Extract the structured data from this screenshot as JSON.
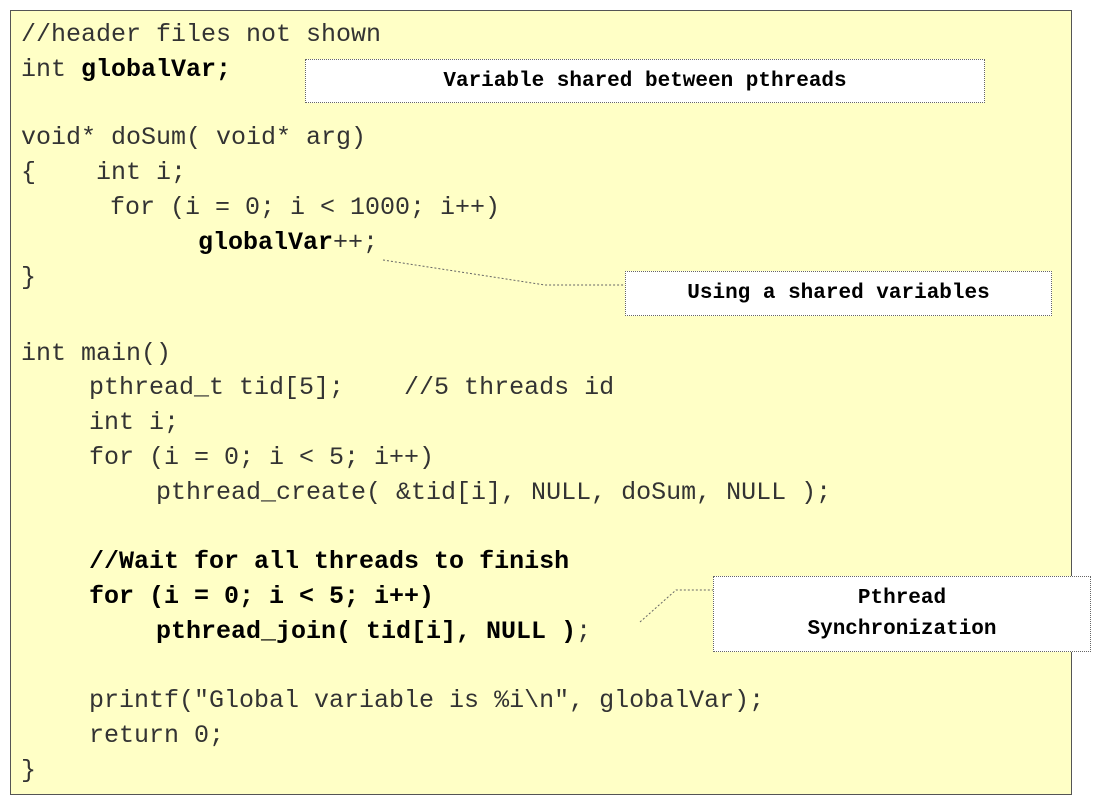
{
  "code": {
    "header_comment": "//header files not shown",
    "global_decl_prefix": "int ",
    "global_decl_var": "globalVar;",
    "func_sig": "void* doSum( void* arg)",
    "func_open": "{    int i;",
    "func_for": "for (i = 0; i < 1000; i++)",
    "func_inc_var": "globalVar",
    "func_inc_rest": "++;",
    "func_close": "}",
    "main_sig": "int main()",
    "tid_decl": "pthread_t tid[5];    //5 threads id",
    "main_int_i": "int i;",
    "main_for_create": "for (i = 0; i < 5; i++)",
    "create_call": "pthread_create( &tid[i], NULL, doSum, NULL );",
    "wait_comment": "//Wait for all threads to finish",
    "join_for": "for (i = 0; i < 5; i++)",
    "join_call": "pthread_join( tid[i], NULL )",
    "join_semicolon": ";",
    "printf_line": "printf(\"Global variable is %i\\n\", globalVar);",
    "return_line": "return 0;",
    "main_close": "}"
  },
  "callouts": {
    "shared_var": "Variable shared between pthreads",
    "using_shared": "Using a shared variables",
    "sync_line1": "Pthread",
    "sync_line2": "Synchronization"
  },
  "colors": {
    "panel_background": "#ffffc6",
    "callout_background": "#ffffff",
    "text": "#333333"
  }
}
